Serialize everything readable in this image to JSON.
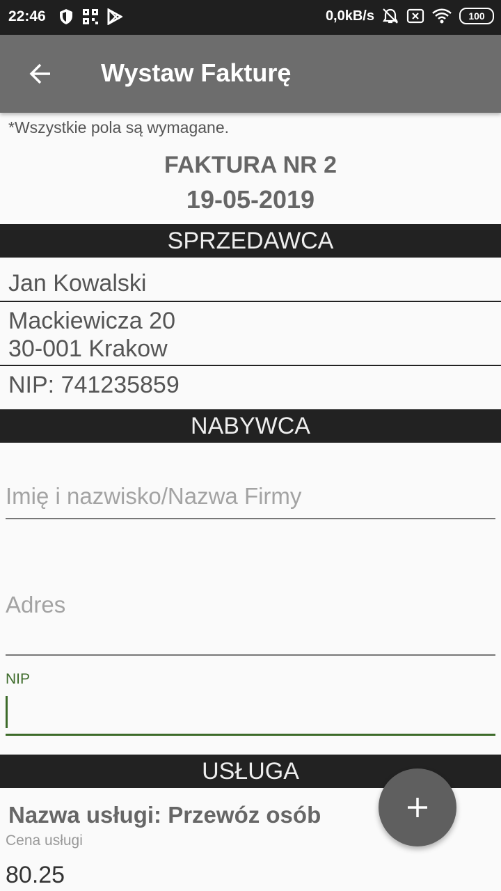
{
  "status_bar": {
    "time": "22:46",
    "network_speed": "0,0kB/s",
    "battery": "100"
  },
  "app_bar": {
    "title": "Wystaw Fakturę",
    "back_icon": "arrow-left-icon"
  },
  "form": {
    "required_note": "*Wszystkie pola są wymagane.",
    "invoice_title": "FAKTURA NR 2",
    "invoice_date": "19-05-2019",
    "seller": {
      "header": "SPRZEDAWCA",
      "name": "Jan Kowalski",
      "address_line1": "Mackiewicza 20",
      "address_line2": "30-001 Krakow",
      "nip": "NIP: 741235859"
    },
    "buyer": {
      "header": "NABYWCA",
      "name_placeholder": "Imię i nazwisko/Nazwa Firmy",
      "address_placeholder": "Adres",
      "nip_label": "NIP",
      "nip_value": ""
    },
    "service": {
      "header": "USŁUGA",
      "name": "Nazwa usługi: Przewóz osób",
      "price_label": "Cena usługi",
      "price_value": "80.25"
    }
  },
  "fab": {
    "icon": "plus-icon"
  },
  "colors": {
    "app_bar": "#6d6d6d",
    "section_header": "#222222",
    "accent_green": "#3d6b2a",
    "fab": "#5f5f5f"
  }
}
